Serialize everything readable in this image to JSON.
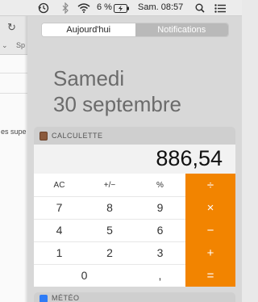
{
  "menubar": {
    "time_machine_icon": "time-machine-icon",
    "bluetooth_icon": "bluetooth-icon",
    "wifi_icon": "wifi-icon",
    "battery_text": "6 %",
    "battery_icon": "battery-charging-icon",
    "clock": "Sam. 08:57",
    "spotlight_icon": "search-icon",
    "notification_icon": "notification-list-icon"
  },
  "background_window": {
    "reload_glyph": "↻",
    "chevron_glyph": "⌄",
    "partial_tab": "Sp",
    "partial_text": "es supe"
  },
  "notification_center": {
    "tabs": [
      {
        "label": "Aujourd'hui",
        "active": true
      },
      {
        "label": "Notifications",
        "active": false
      }
    ],
    "date": {
      "day": "Samedi",
      "full": "30 septembre"
    },
    "calculator": {
      "title": "CALCULETTE",
      "display": "886,54",
      "keys": {
        "ac": "AC",
        "sign": "+/−",
        "percent": "%",
        "divide": "÷",
        "seven": "7",
        "eight": "8",
        "nine": "9",
        "multiply": "×",
        "four": "4",
        "five": "5",
        "six": "6",
        "minus": "−",
        "one": "1",
        "two": "2",
        "three": "3",
        "plus": "+",
        "zero": "0",
        "comma": ",",
        "equals": "="
      },
      "operator_color": "#f28400"
    },
    "next_widget": {
      "title": "MÉTÉO"
    }
  }
}
